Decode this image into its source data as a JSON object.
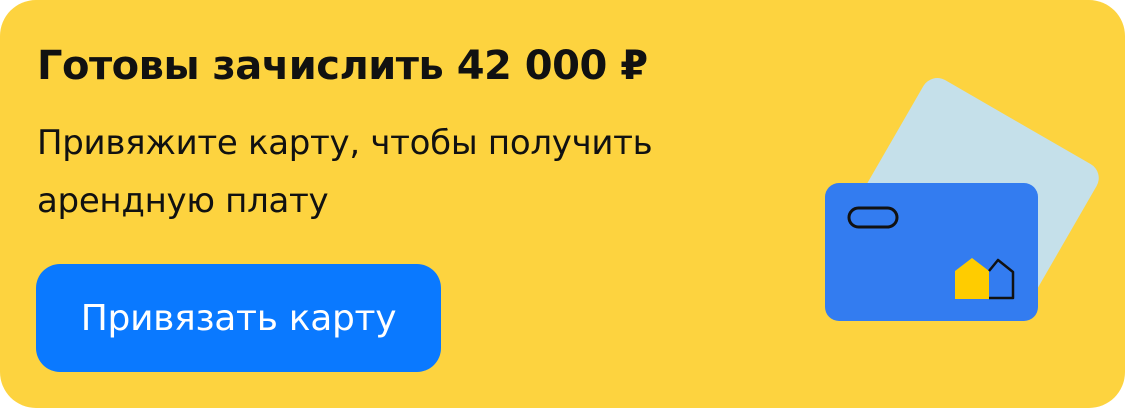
{
  "banner": {
    "title": "Готовы зачислить 42 000 ₽",
    "subtitle": "Привяжите карту, чтобы получить арендную плату",
    "button_label": "Привязать карту"
  },
  "illustration": {
    "icon": "bank-cards-icon",
    "logo_icon": "house-logo-icon"
  },
  "colors": {
    "background": "#FDD33F",
    "button": "#0A79FF",
    "card_front": "#337CF0",
    "card_back": "#C5E0EA",
    "logo_yellow": "#FFCC00"
  }
}
